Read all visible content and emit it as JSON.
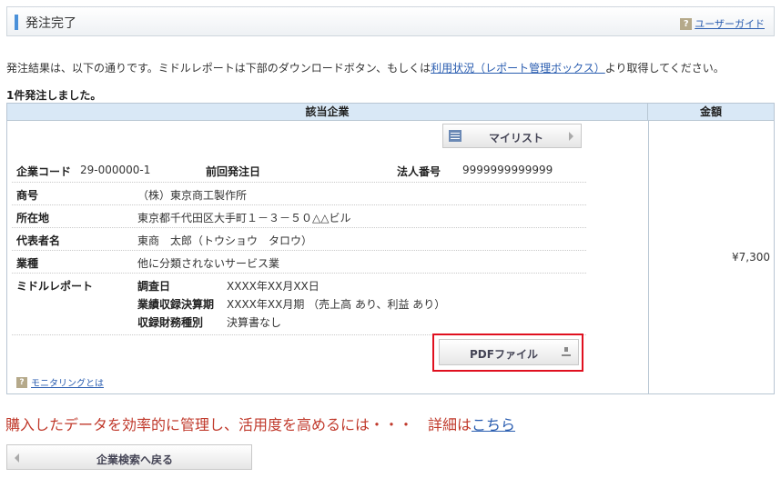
{
  "header": {
    "title": "発注完了",
    "guide_link": "ユーザーガイド",
    "help_glyph": "?"
  },
  "intro": {
    "text_before": "発注結果は、以下の通りです。ミドルレポートは下部のダウンロードボタン、もしくは",
    "link": "利用状況（レポート管理ボックス）",
    "text_after": "より取得してください。"
  },
  "count_text": "1件発注しました。",
  "table": {
    "col_company": "該当企業",
    "col_amount": "金額",
    "amount_value": "¥7,300",
    "mylist_button": "マイリスト",
    "company_code_label": "企業コード",
    "company_code_value": "29-000000-1",
    "prev_order_label": "前回発注日",
    "corp_number_label": "法人番号",
    "corp_number_value": "9999999999999",
    "rows": [
      {
        "label": "商号",
        "value": "（株）東京商工製作所"
      },
      {
        "label": "所在地",
        "value": "東京都千代田区大手町１－３－５０△△ビル"
      },
      {
        "label": "代表者名",
        "value": "東商　太郎（トウショウ　タロウ）"
      },
      {
        "label": "業種",
        "value": "他に分類されないサービス業"
      }
    ],
    "middle_report": {
      "label": "ミドルレポート",
      "items": [
        {
          "label": "調査日",
          "value": "XXXX年XX月XX日"
        },
        {
          "label": "業績収録決算期",
          "value": "XXXX年XX月期 （売上高 あり、利益 あり）"
        },
        {
          "label": "収録財務種別",
          "value": "決算書なし"
        }
      ]
    },
    "pdf_button": "PDFファイル",
    "monitoring_link": "モニタリングとは"
  },
  "promo": {
    "text": "購入したデータを効率的に管理し、活用度を高めるには・・・　詳細は",
    "link": "こちら"
  },
  "back_button": "企業検索へ戻る",
  "colors": {
    "accent": "#4a90d9",
    "highlight_border": "#e0101f",
    "promo_text": "#c0392b",
    "link": "#2a5db0",
    "table_header_bg": "#d9e8f6"
  }
}
